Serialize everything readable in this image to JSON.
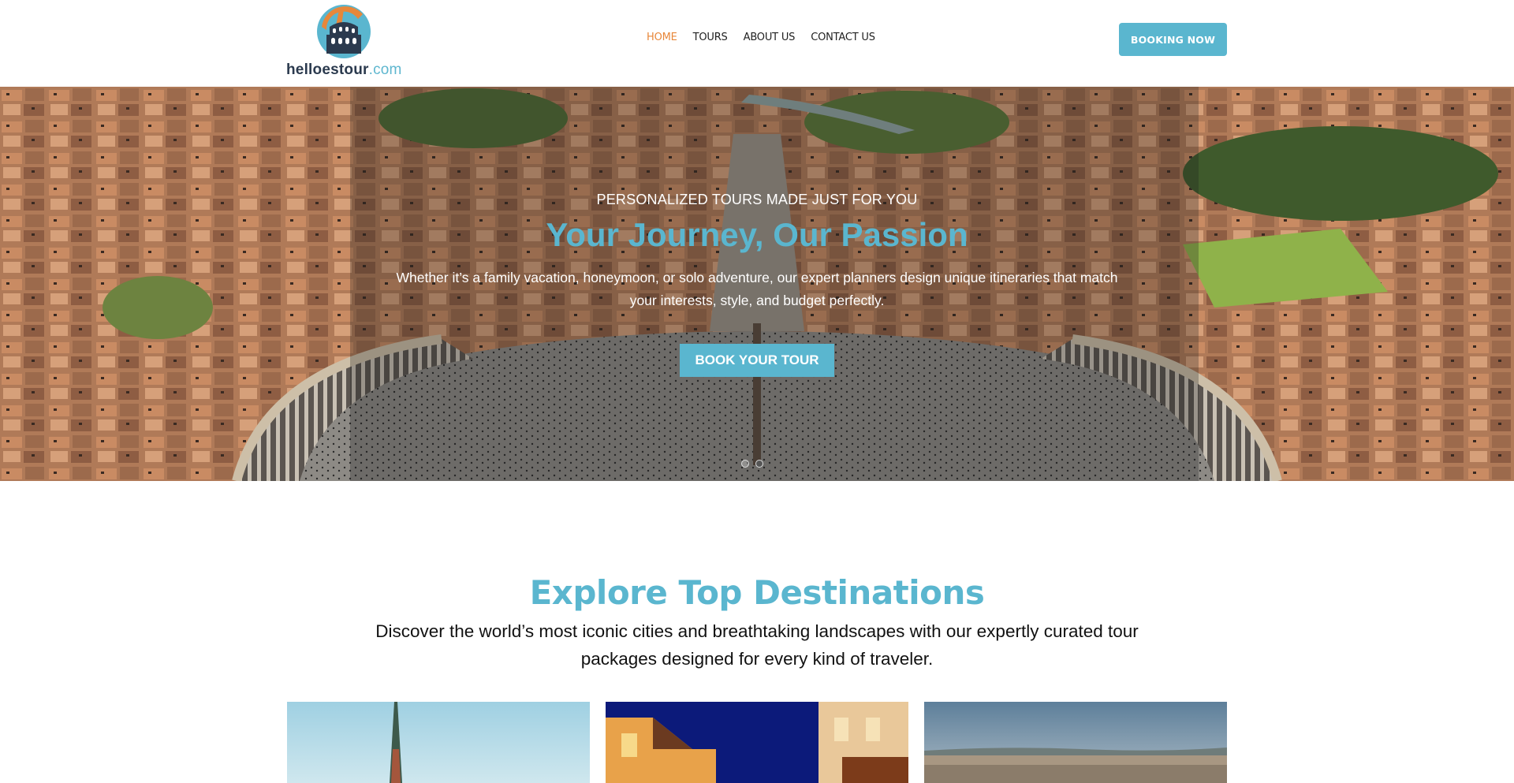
{
  "header": {
    "logo": {
      "name": "helloestour",
      "suffix": ".com"
    },
    "nav": [
      {
        "label": "HOME",
        "active": true
      },
      {
        "label": "TOURS",
        "active": false
      },
      {
        "label": "ABOUT US",
        "active": false
      },
      {
        "label": "CONTACT US",
        "active": false
      }
    ],
    "cta_label": "BOOKING NOW"
  },
  "hero": {
    "eyebrow": "PERSONALIZED TOURS MADE JUST FOR YOU",
    "title": "Your Journey, Our Passion",
    "description": "Whether it’s a family vacation, honeymoon, or solo adventure, our expert planners design unique itineraries that match your interests, style, and budget perfectly.",
    "cta_label": "BOOK YOUR TOUR",
    "slides_total": 2,
    "slide_active": 2
  },
  "explore": {
    "title": "Explore Top Destinations",
    "description": "Discover the world’s most iconic cities and breathtaking landscapes with our expertly curated tour packages designed for every kind of traveler."
  },
  "colors": {
    "accent": "#5ab6cf",
    "nav_active": "#e8873a",
    "text_dark": "#222222"
  }
}
